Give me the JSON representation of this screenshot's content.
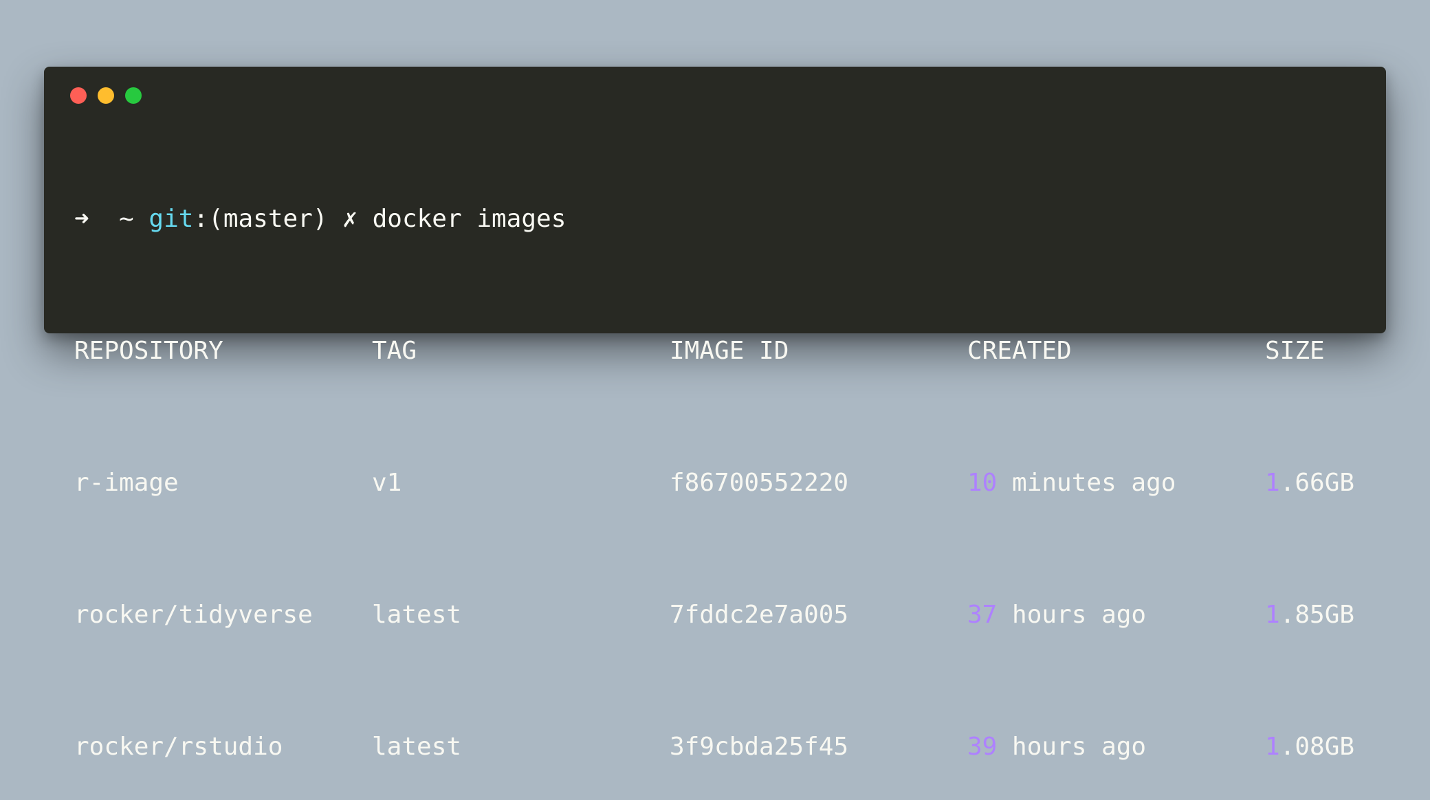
{
  "colors": {
    "background": "#abb8c3",
    "window": "#282923",
    "text": "#f8f8f2",
    "git": "#66d9ef",
    "number": "#ae81ff",
    "close": "#ff5f56",
    "minimize": "#ffbd2e",
    "maximize": "#27c93f"
  },
  "window_controls": [
    "close-button",
    "minimize-button",
    "maximize-button"
  ],
  "prompt": {
    "arrow": "➜",
    "cwd": "~",
    "git_label": "git",
    "branch_open": ":(",
    "branch": "master",
    "branch_close": ")",
    "dirty_mark": "✗",
    "command": "docker images"
  },
  "table": {
    "headers": [
      "REPOSITORY",
      "TAG",
      "IMAGE ID",
      "CREATED",
      "SIZE"
    ],
    "rows": [
      {
        "repository": "r-image",
        "tag": "v1",
        "image_id": "f86700552220",
        "created_num": "10",
        "created_unit": " minutes ago",
        "size_num": "1",
        "size_rest": ".66GB"
      },
      {
        "repository": "rocker/tidyverse",
        "tag": "latest",
        "image_id": "7fddc2e7a005",
        "created_num": "37",
        "created_unit": " hours ago",
        "size_num": "1",
        "size_rest": ".85GB"
      },
      {
        "repository": "rocker/rstudio",
        "tag": "latest",
        "image_id": "3f9cbda25f45",
        "created_num": "39",
        "created_unit": " hours ago",
        "size_num": "1",
        "size_rest": ".08GB"
      }
    ]
  }
}
